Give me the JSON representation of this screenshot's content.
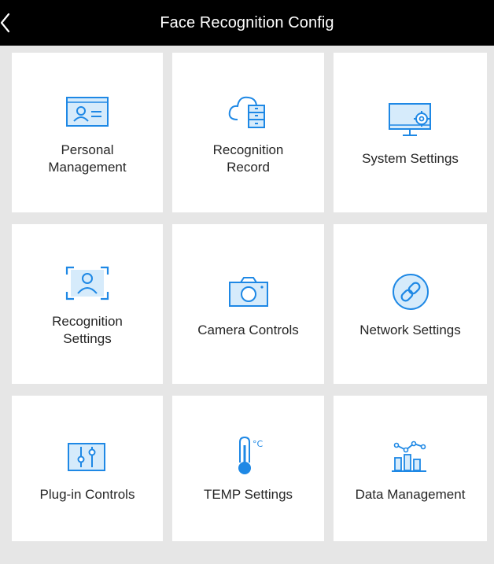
{
  "header": {
    "title": "Face Recognition Config",
    "back_icon": "chevron-left-icon"
  },
  "colors": {
    "header_bg": "#000000",
    "background": "#e6e6e6",
    "tile_bg": "#ffffff",
    "icon_blue": "#1e88e5",
    "icon_light": "#d6ebfb",
    "text": "#262626"
  },
  "tiles": [
    {
      "label": "Personal\nManagement",
      "icon": "id-card-icon"
    },
    {
      "label": "Recognition\nRecord",
      "icon": "cloud-record-icon"
    },
    {
      "label": "System Settings",
      "icon": "monitor-gear-icon"
    },
    {
      "label": "Recognition\nSettings",
      "icon": "face-frame-icon"
    },
    {
      "label": "Camera Controls",
      "icon": "camera-icon"
    },
    {
      "label": "Network Settings",
      "icon": "link-icon"
    },
    {
      "label": "Plug-in Controls",
      "icon": "sliders-icon"
    },
    {
      "label": "TEMP Settings",
      "icon": "thermometer-icon",
      "unit": "°C"
    },
    {
      "label": "Data Management",
      "icon": "bar-chart-icon"
    }
  ]
}
